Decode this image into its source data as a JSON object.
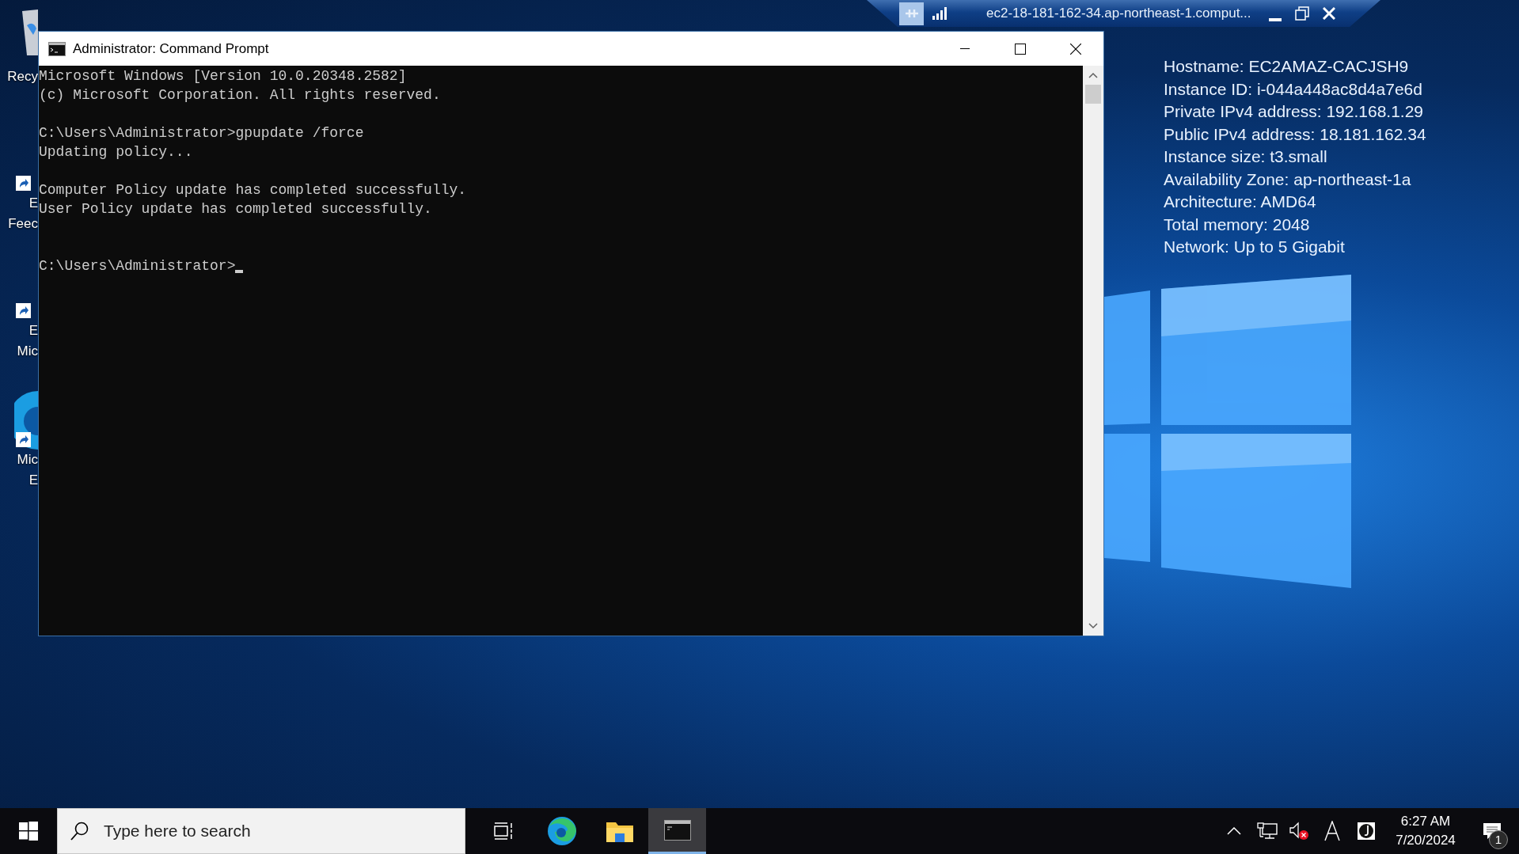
{
  "remote_bar": {
    "title": "ec2-18-181-162-34.ap-northeast-1.comput..."
  },
  "desktop_icons": [
    {
      "kind": "recycle-bin",
      "lines": [
        "Recy"
      ]
    },
    {
      "kind": "shortcut",
      "lines": [
        "E",
        "Feec"
      ]
    },
    {
      "kind": "shortcut",
      "lines": [
        "E",
        "Mic"
      ]
    },
    {
      "kind": "edge-shortcut",
      "lines": [
        "Mic",
        "E"
      ]
    }
  ],
  "console_window": {
    "title": "Administrator: Command Prompt",
    "blocks": [
      [
        "Microsoft Windows [Version 10.0.20348.2582]",
        "(c) Microsoft Corporation. All rights reserved."
      ],
      [
        "C:\\Users\\Administrator>gpupdate /force",
        "Updating policy..."
      ],
      [
        "Computer Policy update has completed successfully.",
        "User Policy update has completed successfully."
      ]
    ],
    "prompt": "C:\\Users\\Administrator>"
  },
  "instance_info": [
    "Hostname: EC2AMAZ-CACJSH9",
    "Instance ID: i-044a448ac8d4a7e6d",
    "Private IPv4 address: 192.168.1.29",
    "Public IPv4 address: 18.181.162.34",
    "Instance size: t3.small",
    "Availability Zone: ap-northeast-1a",
    "Architecture: AMD64",
    "Total memory: 2048",
    "Network: Up to 5 Gigabit"
  ],
  "taskbar": {
    "search": {
      "placeholder": "Type here to search"
    },
    "apps": [
      {
        "kind": "task-view",
        "selected": false
      },
      {
        "kind": "edge",
        "selected": false
      },
      {
        "kind": "explorer",
        "selected": false
      },
      {
        "kind": "terminal",
        "selected": true
      }
    ],
    "time": "6:27 AM",
    "date": "7/20/2024",
    "notification_count": "1"
  }
}
